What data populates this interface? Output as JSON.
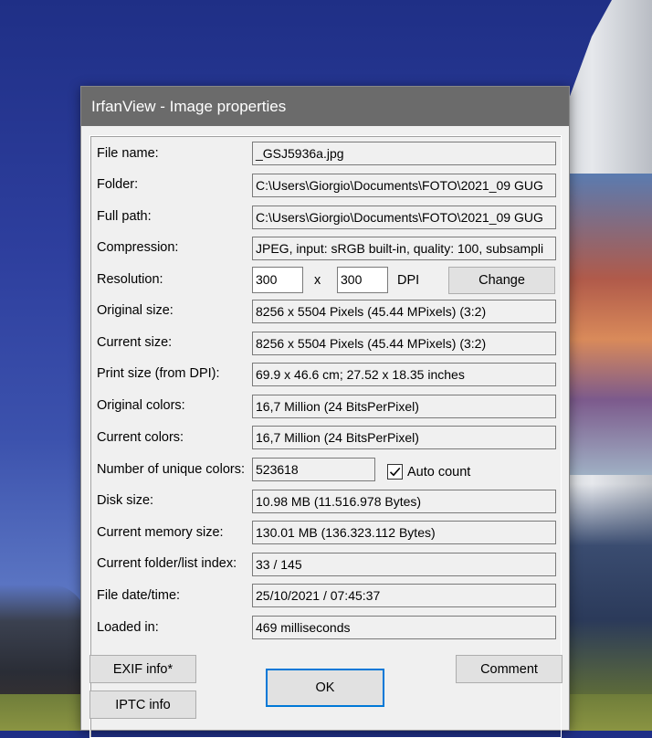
{
  "window": {
    "title": "IrfanView - Image properties"
  },
  "fields": {
    "file_name": {
      "label": "File name:",
      "value": "_GSJ5936a.jpg"
    },
    "folder": {
      "label": "Folder:",
      "value": "C:\\Users\\Giorgio\\Documents\\FOTO\\2021_09 GUG"
    },
    "full_path": {
      "label": "Full path:",
      "value": "C:\\Users\\Giorgio\\Documents\\FOTO\\2021_09 GUG"
    },
    "compression": {
      "label": "Compression:",
      "value": "JPEG, input: sRGB built-in, quality: 100, subsampli"
    },
    "resolution": {
      "label": "Resolution:",
      "x_value": "300",
      "separator": "x",
      "y_value": "300",
      "unit": "DPI",
      "change_button": "Change"
    },
    "original_size": {
      "label": "Original size:",
      "value": "8256 x 5504  Pixels (45.44 MPixels) (3:2)"
    },
    "current_size": {
      "label": "Current size:",
      "value": "8256 x 5504  Pixels (45.44 MPixels) (3:2)"
    },
    "print_size": {
      "label": "Print size (from DPI):",
      "value": "69.9 x 46.6 cm; 27.52 x 18.35 inches"
    },
    "original_colors": {
      "label": "Original colors:",
      "value": "16,7 Million   (24 BitsPerPixel)"
    },
    "current_colors": {
      "label": "Current colors:",
      "value": "16,7 Million   (24 BitsPerPixel)"
    },
    "unique_colors": {
      "label": "Number of unique colors:",
      "value": "523618",
      "auto_count_label": "Auto count",
      "auto_count_checked": true
    },
    "disk_size": {
      "label": "Disk size:",
      "value": "10.98 MB (11.516.978 Bytes)"
    },
    "memory_size": {
      "label": "Current memory size:",
      "value": "130.01  MB (136.323.112 Bytes)"
    },
    "folder_index": {
      "label": "Current folder/list index:",
      "value": "33  /  145"
    },
    "file_date": {
      "label": "File date/time:",
      "value": "25/10/2021 / 07:45:37"
    },
    "loaded_in": {
      "label": "Loaded in:",
      "value": "469 milliseconds"
    }
  },
  "buttons": {
    "exif": "EXIF info*",
    "iptc": "IPTC info",
    "ok": "OK",
    "comment": "Comment"
  },
  "icons": {
    "checkmark": "check-icon"
  }
}
